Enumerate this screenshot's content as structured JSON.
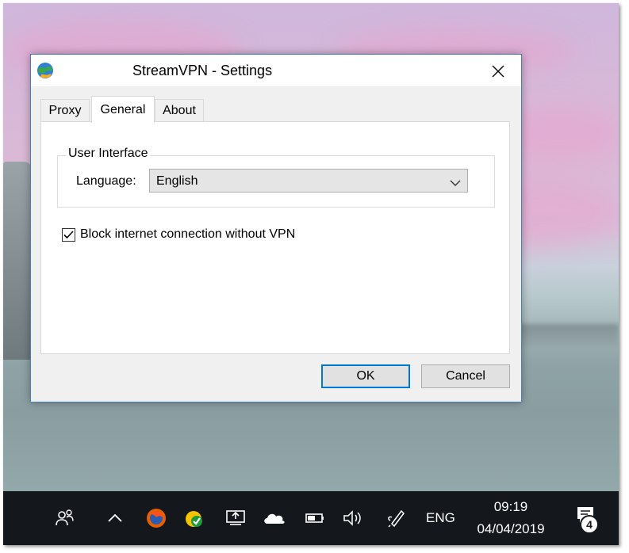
{
  "dialog": {
    "title": "StreamVPN - Settings",
    "tabs": [
      {
        "label": "Proxy",
        "active": false
      },
      {
        "label": "General",
        "active": true
      },
      {
        "label": "About",
        "active": false
      }
    ],
    "group_label": "User Interface",
    "language_label": "Language:",
    "language_value": "English",
    "block_label": "Block internet connection without VPN",
    "block_checked": true,
    "ok_label": "OK",
    "cancel_label": "Cancel"
  },
  "taskbar": {
    "language": "ENG",
    "time": "09:19",
    "date": "04/04/2019",
    "notification_count": "4",
    "icons": [
      "people-icon",
      "chevron-up-icon",
      "firefox-icon",
      "norton-icon",
      "display-icon",
      "onedrive-icon",
      "battery-icon",
      "volume-icon",
      "pen-icon",
      "action-center-icon"
    ]
  },
  "colors": {
    "accent": "#0078d7",
    "taskbar": "#14181c"
  }
}
